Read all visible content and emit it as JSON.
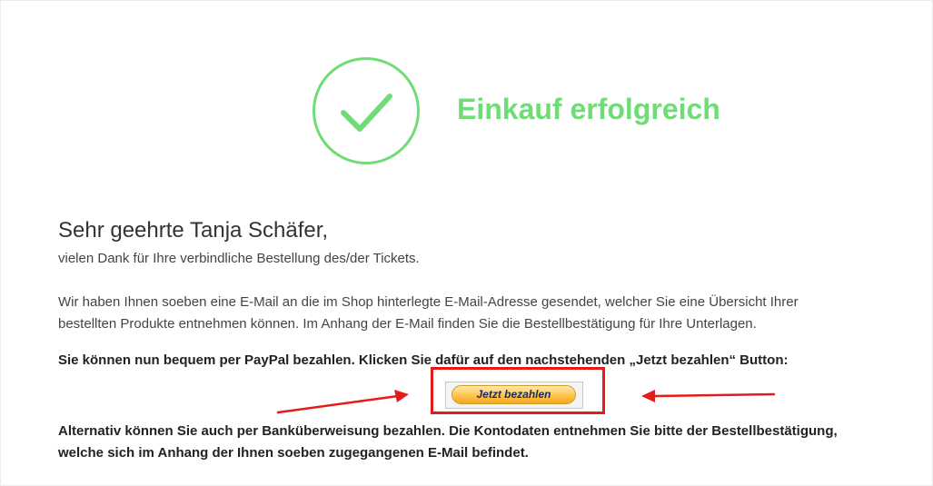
{
  "header": {
    "success_icon": "check-circle-icon",
    "title": "Einkauf erfolgreich"
  },
  "message": {
    "greeting": "Sehr geehrte Tanja Schäfer,",
    "thanks": "vielen Dank für Ihre verbindliche Bestellung des/der Tickets.",
    "email_line1": "Wir haben Ihnen soeben eine E-Mail an die im Shop hinterlegte E-Mail-Adresse gesendet, welcher Sie eine Übersicht Ihrer",
    "email_line2": "bestellten Produkte entnehmen können. Im Anhang der E-Mail finden Sie die Bestellbestätigung für Ihre Unterlagen.",
    "paypal_instruction": "Sie können nun bequem per PayPal bezahlen. Klicken Sie dafür auf den nachstehenden „Jetzt bezahlen“ Button:",
    "alternative_line1": "Alternativ können Sie auch per Banküberweisung bezahlen. Die Kontodaten entnehmen Sie bitte der Bestellbestätigung,",
    "alternative_line2": "welche sich im Anhang der Ihnen soeben zugegangenen E-Mail befindet."
  },
  "payment": {
    "button_label": "Jetzt bezahlen"
  },
  "annotations": {
    "highlight_color": "#e51b1b",
    "left_arrow_icon": "red-arrow-right-icon",
    "right_arrow_icon": "red-arrow-left-icon"
  },
  "colors": {
    "success_green": "#6fdc76",
    "paypal_gold": "#ffc54a",
    "paypal_text": "#1e2b5a"
  }
}
